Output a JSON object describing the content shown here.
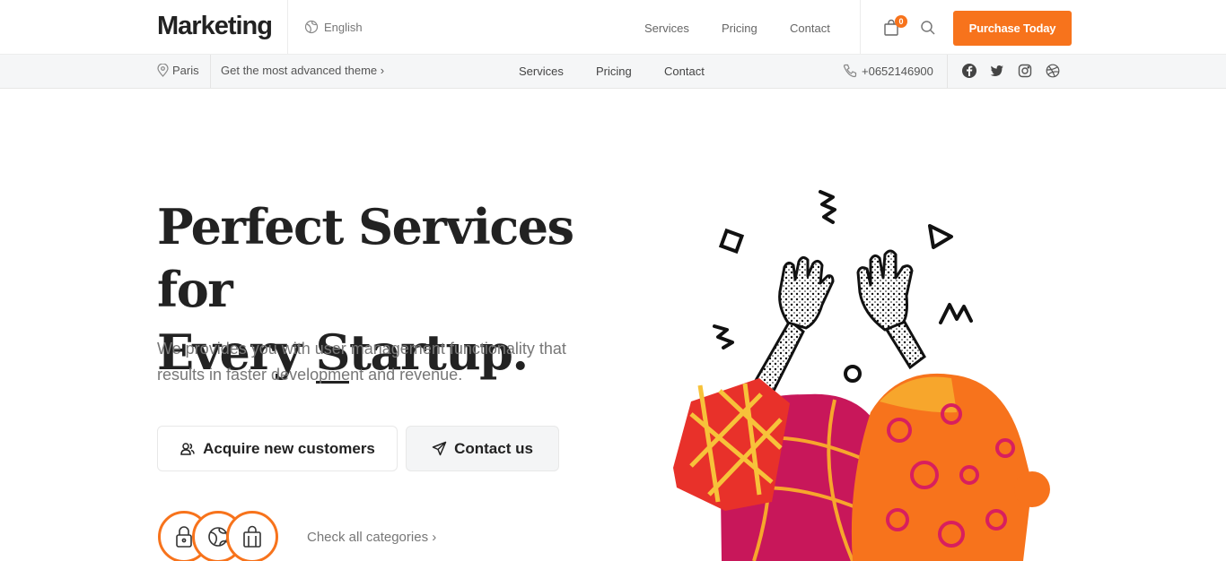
{
  "header": {
    "logo": "Marketing",
    "language": "English",
    "nav": [
      "Services",
      "Pricing",
      "Contact"
    ],
    "cart_count": "0",
    "purchase_label": "Purchase Today"
  },
  "subbar": {
    "city": "Paris",
    "promo": "Get the most advanced theme ›",
    "nav": [
      "Services",
      "Pricing",
      "Contact"
    ],
    "phone": "+0652146900",
    "social_icons": [
      "facebook-icon",
      "twitter-icon",
      "instagram-icon",
      "dribbble-icon"
    ]
  },
  "hero": {
    "title_line1": "Perfect Services for",
    "title_line2_pre": "Every ",
    "title_line2_underlined": "S",
    "title_line2_post": "tartup.",
    "subtitle": "We provides you with user management functionality that results in faster development and revenue.",
    "acquire_label": "Acquire new customers",
    "contact_label": "Contact us",
    "check_categories": "Check all categories ›",
    "category_icons": [
      "lock-icon",
      "globe-icon",
      "shopping-bag-icon"
    ]
  },
  "colors": {
    "accent": "#f7731c",
    "text_dark": "#222222",
    "text_muted": "#777777",
    "subbar_bg": "#f5f6f7"
  }
}
